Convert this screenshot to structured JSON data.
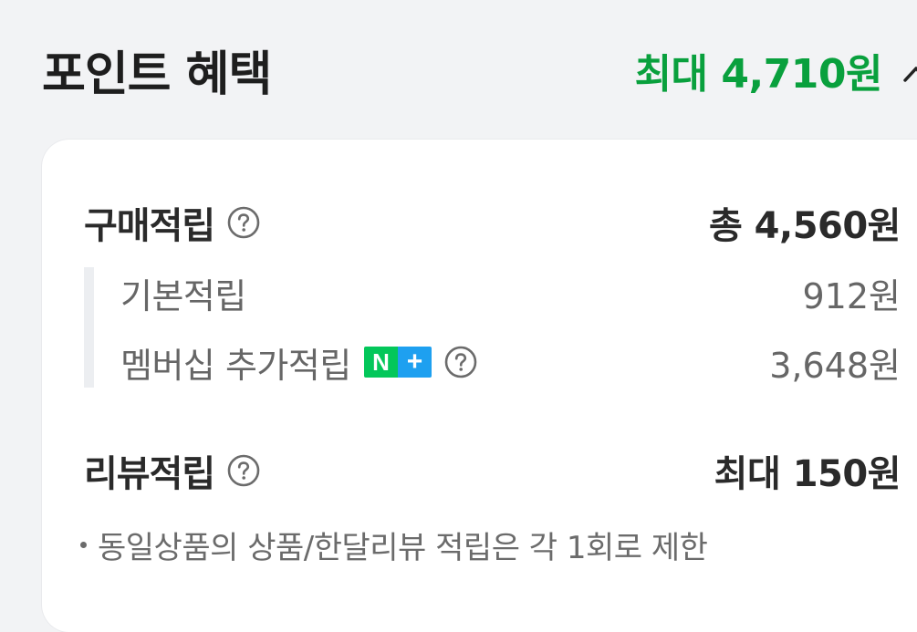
{
  "header": {
    "title": "포인트 혜택",
    "max_total": "최대 4,710원",
    "toggle_icon": "chevron-up-icon"
  },
  "purchase": {
    "title": "구매적립",
    "total": "총 4,560원",
    "help_icon": "question-circle-icon",
    "items": [
      {
        "label": "기본적립",
        "amount": "912원"
      },
      {
        "label": "멤버십 추가적립",
        "amount": "3,648원",
        "badge": {
          "n": "N",
          "plus": "+",
          "n_color": "#03c75a",
          "plus_color": "#1ea0f0"
        }
      }
    ]
  },
  "review": {
    "title": "리뷰적립",
    "total": "최대 150원",
    "help_icon": "question-circle-icon",
    "note": "동일상품의 상품/한달리뷰 적립은 각 1회로 제한"
  },
  "colors": {
    "accent_green": "#09a03d",
    "background": "#f2f3f5",
    "card": "#ffffff"
  }
}
